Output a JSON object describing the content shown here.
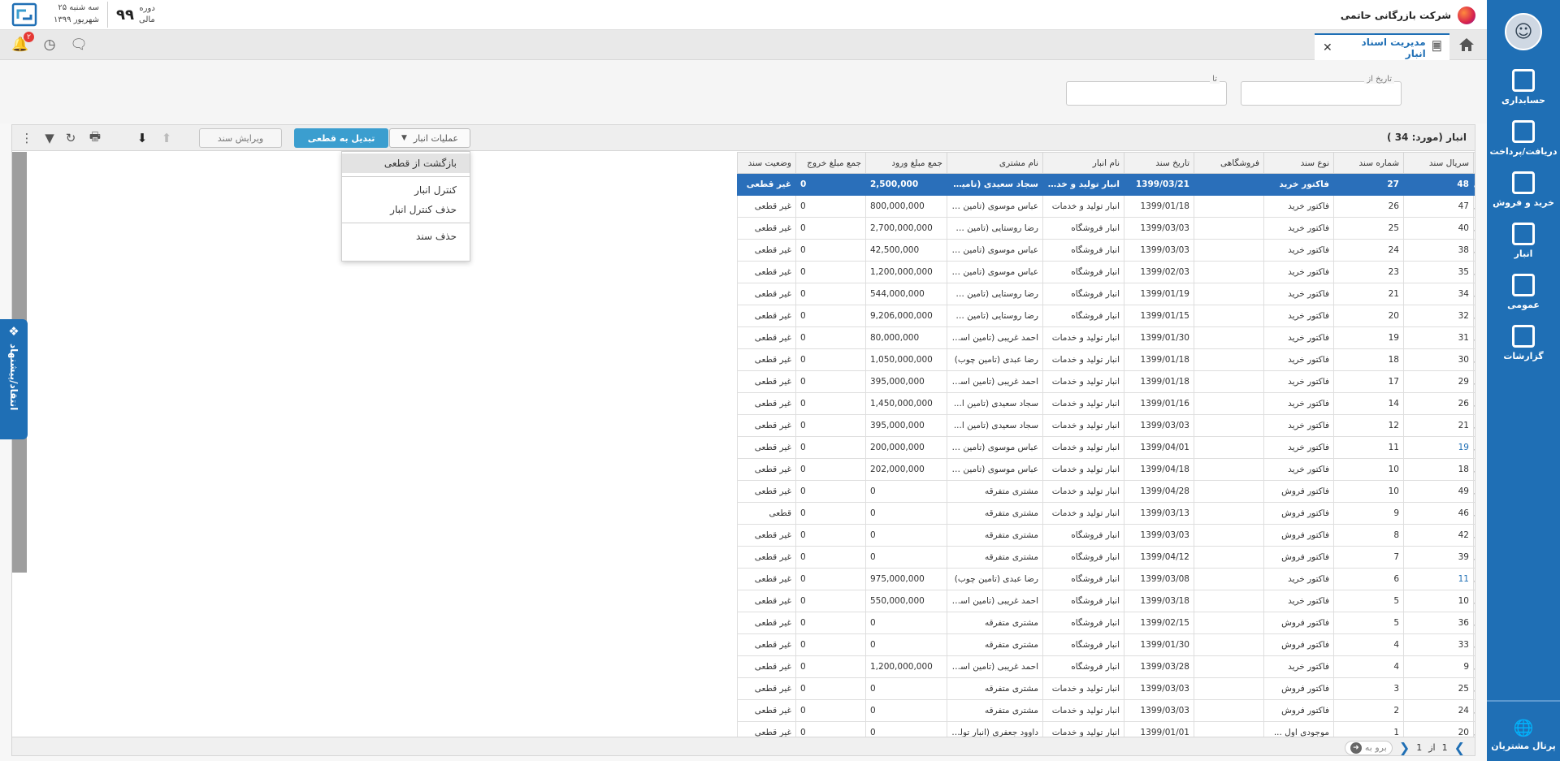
{
  "company": "شرکت بازرگانی حاتمی",
  "date": {
    "day": "سه شنبه ۲۵",
    "month_year": "شهریور ۱۳۹۹"
  },
  "period": {
    "label_1": "دوره",
    "label_2": "مالی",
    "value": "۹۹"
  },
  "notifications_count": "۲",
  "tab": {
    "title": "مدیریت اسناد انبار",
    "close": "✕"
  },
  "nav": [
    {
      "label": "حسابداری",
      "icon": "accounting-icon"
    },
    {
      "label": "دریافت/پرداخت",
      "icon": "payment-icon"
    },
    {
      "label": "خرید و فروش",
      "icon": "cart-icon"
    },
    {
      "label": "انبار",
      "icon": "warehouse-icon"
    },
    {
      "label": "عمومی",
      "icon": "general-icon"
    },
    {
      "label": "گزارشات",
      "icon": "reports-icon"
    }
  ],
  "portal": "پرتال مشتریان",
  "filter": {
    "from_label": "تاریخ از",
    "to_label": "تا"
  },
  "grid": {
    "title": "انبار (مورد: 34 )",
    "convert_button": "تبدیل به قطعی",
    "ops_button": "عملیات انبار",
    "edit_button": "ویرایش سند",
    "columns": [
      "سریال سند",
      "شماره سند",
      "نوع سند",
      "فروشگاهی",
      "تاریخ سند",
      "نام انبار",
      "نام مشتری",
      "جمع مبلغ ورود",
      "جمع مبلغ خروج",
      "وضعیت سند"
    ],
    "rows": [
      [
        "48",
        "27",
        "فاکتور خرید",
        "",
        "1399/03/21",
        "انبار تولید و خدمات",
        "سجاد سعیدی (تامین ا...",
        "2,500,000",
        "0",
        "غیر قطعی"
      ],
      [
        "47",
        "26",
        "فاکتور خرید",
        "",
        "1399/01/18",
        "انبار تولید و خدمات",
        "عباس موسوی (تامین ک...",
        "800,000,000",
        "0",
        "غیر قطعی"
      ],
      [
        "40",
        "25",
        "فاکتور خرید",
        "",
        "1399/03/03",
        "انبار فروشگاه",
        "رضا روستایی (تامین مـ...",
        "2,700,000,000",
        "0",
        "غیر قطعی"
      ],
      [
        "38",
        "24",
        "فاکتور خرید",
        "",
        "1399/03/03",
        "انبار فروشگاه",
        "عباس موسوی (تامین ک...",
        "42,500,000",
        "0",
        "غیر قطعی"
      ],
      [
        "35",
        "23",
        "فاکتور خرید",
        "",
        "1399/02/03",
        "انبار فروشگاه",
        "عباس موسوی (تامین ک...",
        "1,200,000,000",
        "0",
        "غیر قطعی"
      ],
      [
        "34",
        "21",
        "فاکتور خرید",
        "",
        "1399/01/19",
        "انبار فروشگاه",
        "رضا روستایی (تامین مـ...",
        "544,000,000",
        "0",
        "غیر قطعی"
      ],
      [
        "32",
        "20",
        "فاکتور خرید",
        "",
        "1399/01/15",
        "انبار فروشگاه",
        "رضا روستایی (تامین مـ...",
        "9,206,000,000",
        "0",
        "غیر قطعی"
      ],
      [
        "31",
        "19",
        "فاکتور خرید",
        "",
        "1399/01/30",
        "انبار تولید و خدمات",
        "احمد غریبی (تامین اسف...",
        "80,000,000",
        "0",
        "غیر قطعی"
      ],
      [
        "30",
        "18",
        "فاکتور خرید",
        "",
        "1399/01/18",
        "انبار تولید و خدمات",
        "رضا عبدی (تامین چوب)",
        "1,050,000,000",
        "0",
        "غیر قطعی"
      ],
      [
        "29",
        "17",
        "فاکتور خرید",
        "",
        "1399/01/18",
        "انبار تولید و خدمات",
        "احمد غریبی (تامین اسف...",
        "395,000,000",
        "0",
        "غیر قطعی"
      ],
      [
        "26",
        "14",
        "فاکتور خرید",
        "",
        "1399/01/16",
        "انبار تولید و خدمات",
        "سجاد سعیدی (تامین ا...",
        "1,450,000,000",
        "0",
        "غیر قطعی"
      ],
      [
        "21",
        "12",
        "فاکتور خرید",
        "",
        "1399/03/03",
        "انبار تولید و خدمات",
        "سجاد سعیدی (تامین ا...",
        "395,000,000",
        "0",
        "غیر قطعی"
      ],
      [
        "19",
        "11",
        "فاکتور خرید",
        "",
        "1399/04/01",
        "انبار تولید و خدمات",
        "عباس موسوی (تامین ک...",
        "200,000,000",
        "0",
        "غیر قطعی"
      ],
      [
        "18",
        "10",
        "فاکتور خرید",
        "",
        "1399/04/18",
        "انبار تولید و خدمات",
        "عباس موسوی (تامین ک...",
        "202,000,000",
        "0",
        "غیر قطعی"
      ],
      [
        "49",
        "10",
        "فاکتور فروش",
        "",
        "1399/04/28",
        "انبار تولید و خدمات",
        "مشتری متفرقه",
        "0",
        "0",
        "غیر قطعی"
      ],
      [
        "46",
        "9",
        "فاکتور فروش",
        "",
        "1399/03/13",
        "انبار تولید و خدمات",
        "مشتری متفرقه",
        "0",
        "0",
        "قطعی"
      ],
      [
        "42",
        "8",
        "فاکتور فروش",
        "",
        "1399/03/03",
        "انبار فروشگاه",
        "مشتری متفرقه",
        "0",
        "0",
        "غیر قطعی"
      ],
      [
        "39",
        "7",
        "فاکتور فروش",
        "",
        "1399/04/12",
        "انبار فروشگاه",
        "مشتری متفرقه",
        "0",
        "0",
        "غیر قطعی"
      ],
      [
        "11",
        "6",
        "فاکتور خرید",
        "",
        "1399/03/08",
        "انبار فروشگاه",
        "رضا عبدی (تامین چوب)",
        "975,000,000",
        "0",
        "غیر قطعی"
      ],
      [
        "10",
        "5",
        "فاکتور خرید",
        "",
        "1399/03/18",
        "انبار فروشگاه",
        "احمد غریبی (تامین اسف...",
        "550,000,000",
        "0",
        "غیر قطعی"
      ],
      [
        "36",
        "5",
        "فاکتور فروش",
        "",
        "1399/02/15",
        "انبار فروشگاه",
        "مشتری متفرقه",
        "0",
        "0",
        "غیر قطعی"
      ],
      [
        "33",
        "4",
        "فاکتور فروش",
        "",
        "1399/01/30",
        "انبار فروشگاه",
        "مشتری متفرقه",
        "0",
        "0",
        "غیر قطعی"
      ],
      [
        "9",
        "4",
        "فاکتور خرید",
        "",
        "1399/03/28",
        "انبار فروشگاه",
        "احمد غریبی (تامین اسف...",
        "1,200,000,000",
        "0",
        "غیر قطعی"
      ],
      [
        "25",
        "3",
        "فاکتور فروش",
        "",
        "1399/03/03",
        "انبار تولید و خدمات",
        "مشتری متفرقه",
        "0",
        "0",
        "غیر قطعی"
      ],
      [
        "24",
        "2",
        "فاکتور فروش",
        "",
        "1399/03/03",
        "انبار تولید و خدمات",
        "مشتری متفرقه",
        "0",
        "0",
        "غیر قطعی"
      ],
      [
        "20",
        "1",
        "موجودی اول ...",
        "",
        "1399/01/01",
        "انبار تولید و خدمات",
        "داوود جعفری (انبار تولید)",
        "0",
        "0",
        "غیر قطعی"
      ]
    ],
    "blue_serials": [
      "11",
      "19"
    ],
    "selected_row": 0
  },
  "menu": [
    "بازگشت از قطعی",
    "کنترل انبار",
    "حذف کنترل انبار",
    "حذف سند"
  ],
  "pager": {
    "page": "1",
    "of": "از",
    "total": "1",
    "goto": "برو به"
  },
  "feedback": "انتقاد/پیشنهاد",
  "colors": {
    "primary": "#1f6fb5",
    "accent": "#3b9ecf",
    "selected_row": "#2a6fba"
  }
}
